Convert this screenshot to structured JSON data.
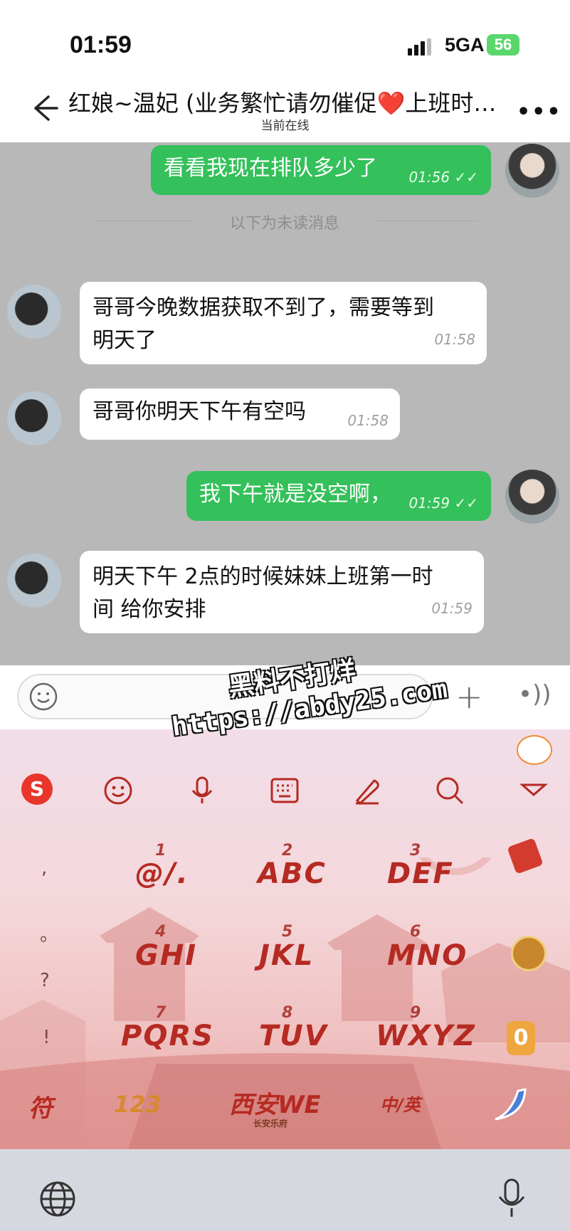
{
  "status_bar": {
    "time": "01:59",
    "network": "5GA",
    "battery": "56"
  },
  "header": {
    "title": "红娘~温妃 (业务繁忙请勿催促❤️上班时…",
    "subtitle": "当前在线"
  },
  "chat": {
    "unread_divider": "以下为未读消息",
    "messages": [
      {
        "text": "看看我现在排队多少了",
        "time": "01:56"
      },
      {
        "text": "哥哥今晚数据获取不到了，需要等到明天了",
        "line1": "哥哥今晚数据获取不到了，需要等到",
        "line2": "明天了",
        "time": "01:58"
      },
      {
        "text": "哥哥你明天下午有空吗",
        "time": "01:58"
      },
      {
        "text": "我下午就是没空啊，",
        "time": "01:59"
      },
      {
        "text": "明天下午 2点的时候妹妹上班第一时间 给你安排",
        "line1": "明天下午 2点的时候妹妹上班第一时",
        "line2": "间 给你安排",
        "time": "01:59"
      }
    ]
  },
  "watermark": {
    "line1": "黑料不打烊",
    "line2": "https://abdy25.com"
  },
  "keyboard": {
    "punctuation": [
      ",",
      "。",
      "?",
      "!"
    ],
    "keys": [
      {
        "num": "1",
        "label": "@/."
      },
      {
        "num": "2",
        "label": "ABC"
      },
      {
        "num": "3",
        "label": "DEF"
      },
      {
        "num": "4",
        "label": "GHI"
      },
      {
        "num": "5",
        "label": "JKL"
      },
      {
        "num": "6",
        "label": "MNO"
      },
      {
        "num": "7",
        "label": "PQRS"
      },
      {
        "num": "8",
        "label": "TUV"
      },
      {
        "num": "9",
        "label": "WXYZ"
      }
    ],
    "bottom": {
      "symbols": "符",
      "numbers": "123",
      "space": "西安WE",
      "space_sub": "长安乐府",
      "lang": "中/英",
      "zero": "0"
    }
  },
  "colors": {
    "outgoing_bubble": "#34c05a",
    "chat_bg": "#b8b8b8",
    "keyboard_accent": "#b52a22"
  }
}
